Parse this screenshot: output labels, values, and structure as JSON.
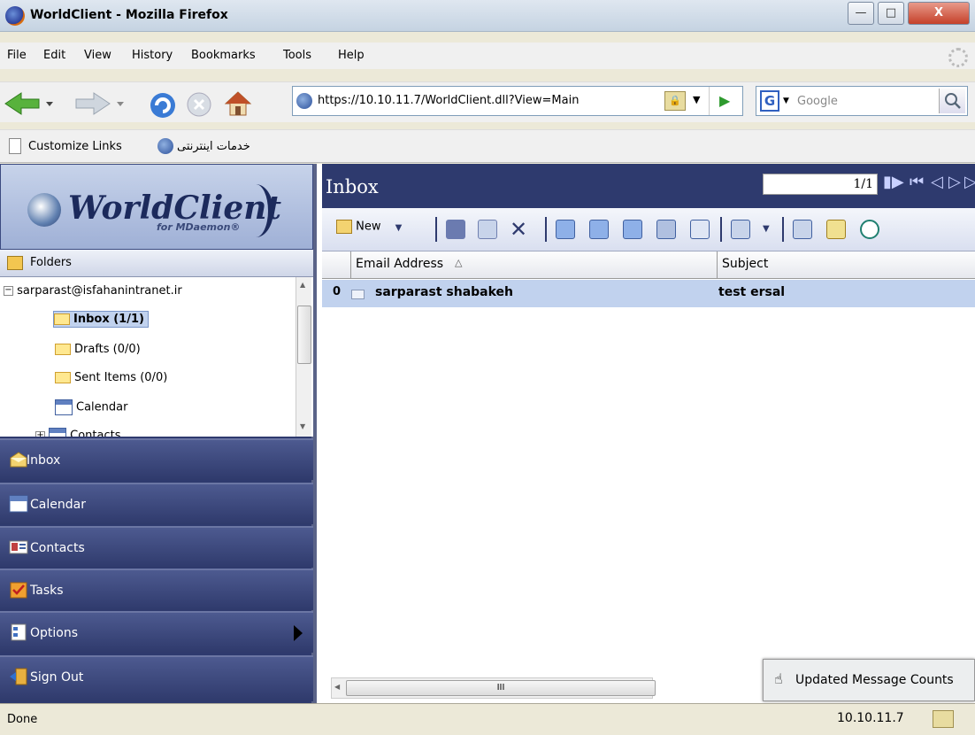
{
  "window": {
    "title": "WorldClient - Mozilla Firefox",
    "min_label": "—",
    "max_label": "□",
    "close_label": "X"
  },
  "menu": [
    "File",
    "Edit",
    "View",
    "History",
    "Bookmarks",
    "Tools",
    "Help"
  ],
  "nav": {
    "url": "https://10.10.11.7/WorldClient.dll?View=Main",
    "search_placeholder": "Google",
    "dropdown_glyph": "▼",
    "go_glyph": "▶"
  },
  "links": {
    "customize": "Customize Links",
    "farsi_link": "خدمات اینترنتی"
  },
  "logo": {
    "title": "WorldClient",
    "subtitle": "for MDaemon®"
  },
  "folders": {
    "header": "Folders",
    "account": "sarparast@isfahanintranet.ir",
    "items": [
      {
        "label": "Inbox (1/1)",
        "selected": true
      },
      {
        "label": "Drafts (0/0)"
      },
      {
        "label": "Sent Items (0/0)"
      },
      {
        "label": "Calendar"
      },
      {
        "label": "Contacts"
      }
    ]
  },
  "sidenav": [
    {
      "label": "Inbox",
      "icon": "inbox-icon"
    },
    {
      "label": "Calendar",
      "icon": "calendar-icon"
    },
    {
      "label": "Contacts",
      "icon": "contacts-icon"
    },
    {
      "label": "Tasks",
      "icon": "tasks-icon"
    },
    {
      "label": "Options",
      "icon": "options-icon"
    },
    {
      "label": "Sign Out",
      "icon": "sign-out-icon"
    }
  ],
  "mailbox": {
    "title": "Inbox",
    "page": "1/1",
    "new_label": "New",
    "columns": {
      "email": "Email Address",
      "subject": "Subject"
    },
    "sort_glyph": "△",
    "messages": [
      {
        "from": "sarparast shabakeh",
        "subject": "test ersal",
        "attachment": true
      }
    ],
    "scroll_grip": "III"
  },
  "toast": {
    "text": "Updated Message Counts"
  },
  "status": {
    "text": "Done",
    "host": "10.10.11.7"
  },
  "colors": {
    "sidebar": "#2e3a6e",
    "selected": "#c1d2ee"
  }
}
